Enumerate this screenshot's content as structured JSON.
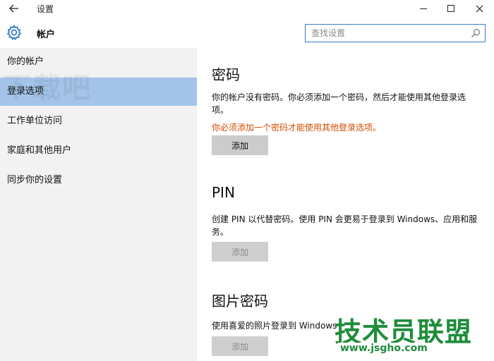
{
  "window": {
    "title": "设置",
    "back_icon": "arrow-left-icon",
    "controls": [
      "minimize-icon",
      "maximize-icon",
      "close-icon"
    ]
  },
  "header": {
    "icon": "gear-icon",
    "title": "帐户",
    "search": {
      "value": "",
      "placeholder": "查找设置",
      "icon": "search-icon"
    }
  },
  "sidebar": {
    "items": [
      {
        "label": "你的帐户",
        "active": false
      },
      {
        "label": "登录选项",
        "active": true
      },
      {
        "label": "工作单位访问",
        "active": false
      },
      {
        "label": "家庭和其他用户",
        "active": false
      },
      {
        "label": "同步你的设置",
        "active": false
      }
    ]
  },
  "main": {
    "password": {
      "title": "密码",
      "description": "你的帐户没有密码。你必须添加一个密码，然后才能使用其他登录选项。",
      "warning": "你必须添加一个密码才能使用其他登录选项。",
      "button": "添加"
    },
    "pin": {
      "title": "PIN",
      "description": "创建 PIN 以代替密码。使用 PIN 会更易于登录到 Windows、应用和服务。",
      "button": "添加"
    },
    "picture_password": {
      "title": "图片密码",
      "description": "使用喜爱的照片登录到 Windows",
      "button": "添加"
    }
  },
  "watermarks": {
    "top": "下载吧",
    "bottom": "技术员联盟",
    "bottom_url": "www.jsgho.com"
  },
  "colors": {
    "accent": "#3a7bd5",
    "active_item": "#a3c4e8",
    "warning": "#d24c00",
    "sidebar_bg": "#f2f2f2"
  }
}
